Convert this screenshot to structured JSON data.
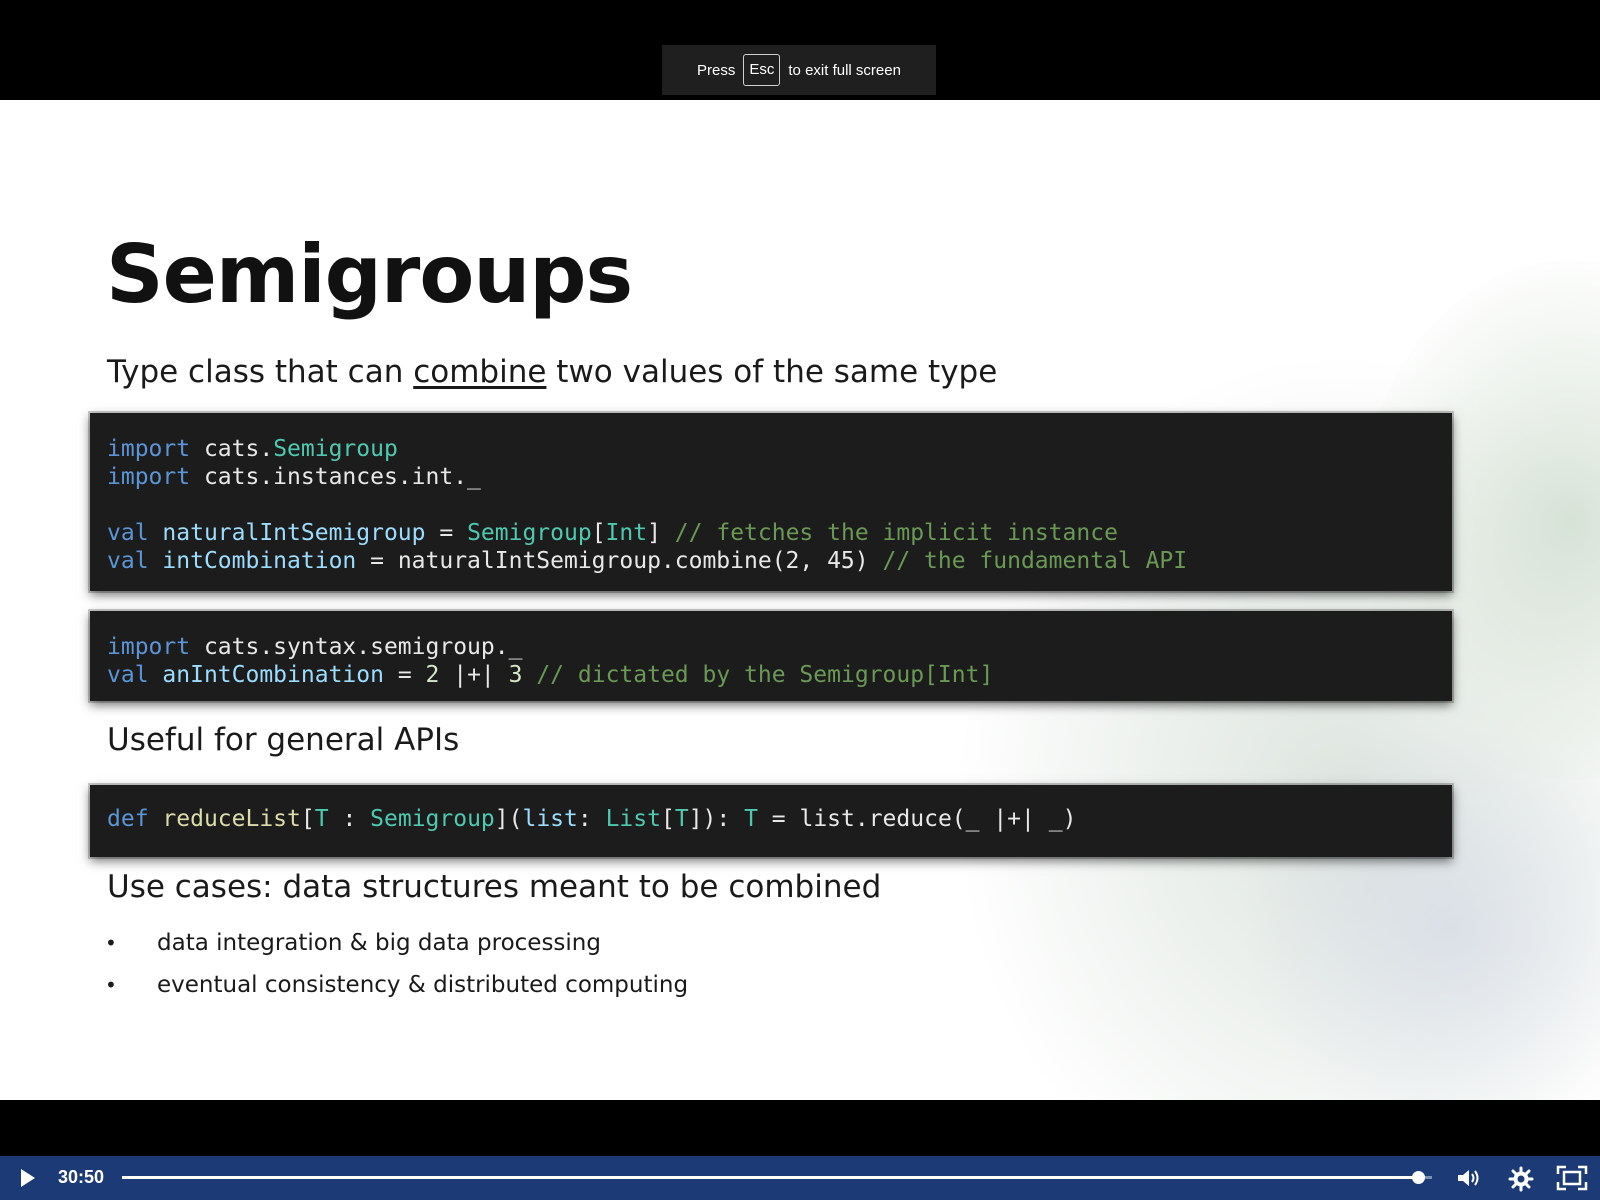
{
  "fullscreen_notice": {
    "prefix": "Press",
    "key": "Esc",
    "suffix": "to exit full screen"
  },
  "slide": {
    "title": "Semigroups",
    "subtitle": {
      "before": "Type class that can ",
      "emphasis": "combine",
      "after": " two values of the same type"
    },
    "code1": {
      "l1_kw": "import",
      "l1_rest": " cats.",
      "l1_type": "Semigroup",
      "l2_kw": "import",
      "l2_rest": " cats.instances.int._",
      "l4_kw": "val",
      "l4_id": "naturalIntSemigroup",
      "l4_eq": " = ",
      "l4_type": "Semigroup",
      "l4_b1": "[",
      "l4_int": "Int",
      "l4_b2": "]",
      "l4_comment": " // fetches the implicit instance",
      "l5_kw": "val",
      "l5_id": "intCombination",
      "l5_mid": " = naturalIntSemigroup.combine(2, 45)",
      "l5_comment": " // the fundamental API"
    },
    "code2": {
      "l1_kw": "import",
      "l1_rest": " cats.syntax.semigroup._",
      "l2_kw": "val",
      "l2_id": "anIntCombination",
      "l2_eq": " = ",
      "l2_n1": "2",
      "l2_op": " |+| ",
      "l2_n2": "3",
      "l2_comment": " // dictated by the Semigroup[Int]"
    },
    "section2": "Useful for general APIs",
    "code3": {
      "kw": "def",
      "fn": "reduceList",
      "p1": "[",
      "t1": "T",
      "p2": " : ",
      "sg": "Semigroup",
      "p3": "](",
      "arg": "list",
      "p4": ": ",
      "lst": "List",
      "p5": "[",
      "t2": "T",
      "p6": "]): ",
      "t3": "T",
      "p7": " = list.reduce(_ |+| _)"
    },
    "section3": "Use cases: data structures meant to be combined",
    "bullets": [
      "data integration & big data processing",
      "eventual consistency & distributed computing"
    ]
  },
  "player": {
    "time": "30:50",
    "progress": 0.989,
    "icons": {
      "play": "play-icon",
      "volume": "volume-icon",
      "settings": "gear-icon",
      "fullscreen": "fullscreen-icon"
    }
  }
}
